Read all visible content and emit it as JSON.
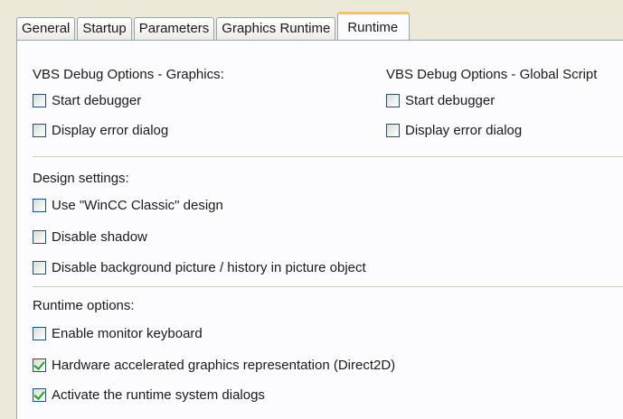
{
  "tabs": [
    {
      "label": "General",
      "active": false
    },
    {
      "label": "Startup",
      "active": false
    },
    {
      "label": "Parameters",
      "active": false
    },
    {
      "label": "Graphics Runtime",
      "active": false
    },
    {
      "label": "Runtime",
      "active": true
    }
  ],
  "vbs_graphics": {
    "heading": "VBS Debug Options - Graphics:",
    "start_debugger": {
      "label": "Start debugger",
      "checked": false
    },
    "display_error_dialog": {
      "label": "Display error dialog",
      "checked": false
    }
  },
  "vbs_global": {
    "heading": "VBS Debug Options - Global Script",
    "start_debugger": {
      "label": "Start debugger",
      "checked": false
    },
    "display_error_dialog": {
      "label": "Display error dialog",
      "checked": false
    }
  },
  "design": {
    "heading": "Design settings:",
    "use_classic": {
      "label": "Use \"WinCC Classic\" design",
      "checked": false
    },
    "disable_shadow": {
      "label": "Disable shadow",
      "checked": false
    },
    "disable_background": {
      "label": "Disable background picture / history in picture object",
      "checked": false
    }
  },
  "runtime_options": {
    "heading": "Runtime options:",
    "monitor_keyboard": {
      "label": "Enable monitor keyboard",
      "checked": false
    },
    "direct2d": {
      "label": "Hardware accelerated graphics representation (Direct2D)",
      "checked": true
    },
    "system_dialogs": {
      "label": "Activate the runtime system dialogs",
      "checked": true
    }
  },
  "colors": {
    "background": "#ece9d8",
    "panel": "#fcfcfe",
    "active_tab_accent": "#ffc83c",
    "checkmark": "#21a121"
  }
}
